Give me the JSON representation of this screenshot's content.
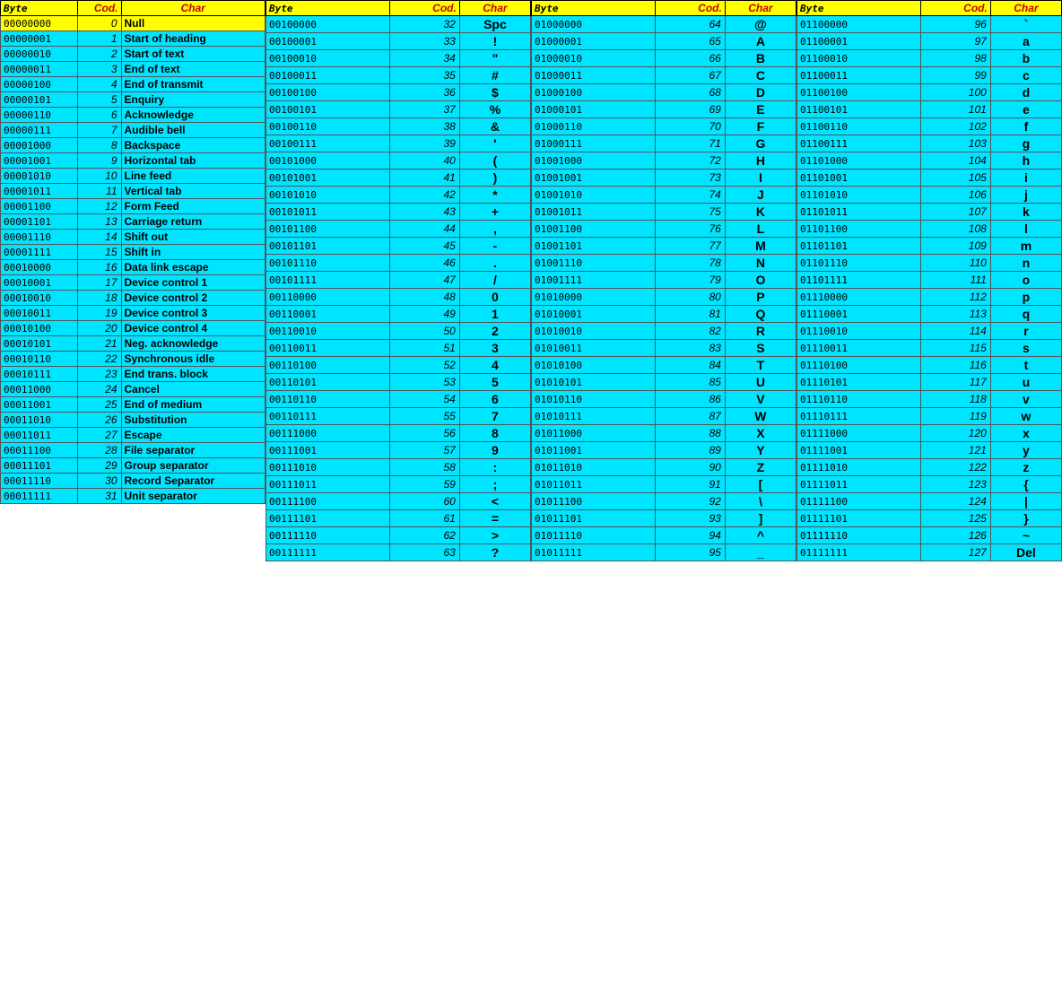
{
  "sections": [
    {
      "id": "s0",
      "headers": [
        "Byte",
        "Cod.",
        "Char"
      ],
      "rows": [
        {
          "byte": "00000000",
          "cod": 0,
          "char": "Null",
          "type": "yellow"
        },
        {
          "byte": "00000001",
          "cod": 1,
          "char": "Start of heading",
          "type": "control"
        },
        {
          "byte": "00000010",
          "cod": 2,
          "char": "Start of text",
          "type": "control"
        },
        {
          "byte": "00000011",
          "cod": 3,
          "char": "End of text",
          "type": "control"
        },
        {
          "byte": "00000100",
          "cod": 4,
          "char": "End of transmit",
          "type": "control"
        },
        {
          "byte": "00000101",
          "cod": 5,
          "char": "Enquiry",
          "type": "control"
        },
        {
          "byte": "00000110",
          "cod": 6,
          "char": "Acknowledge",
          "type": "control"
        },
        {
          "byte": "00000111",
          "cod": 7,
          "char": "Audible bell",
          "type": "control"
        },
        {
          "byte": "00001000",
          "cod": 8,
          "char": "Backspace",
          "type": "control"
        },
        {
          "byte": "00001001",
          "cod": 9,
          "char": "Horizontal tab",
          "type": "control"
        },
        {
          "byte": "00001010",
          "cod": 10,
          "char": "Line feed",
          "type": "control"
        },
        {
          "byte": "00001011",
          "cod": 11,
          "char": "Vertical tab",
          "type": "control"
        },
        {
          "byte": "00001100",
          "cod": 12,
          "char": "Form Feed",
          "type": "control"
        },
        {
          "byte": "00001101",
          "cod": 13,
          "char": "Carriage return",
          "type": "control"
        },
        {
          "byte": "00001110",
          "cod": 14,
          "char": "Shift out",
          "type": "control"
        },
        {
          "byte": "00001111",
          "cod": 15,
          "char": "Shift in",
          "type": "control"
        },
        {
          "byte": "00010000",
          "cod": 16,
          "char": "Data link escape",
          "type": "control"
        },
        {
          "byte": "00010001",
          "cod": 17,
          "char": "Device control 1",
          "type": "control"
        },
        {
          "byte": "00010010",
          "cod": 18,
          "char": "Device control 2",
          "type": "control"
        },
        {
          "byte": "00010011",
          "cod": 19,
          "char": "Device control 3",
          "type": "control"
        },
        {
          "byte": "00010100",
          "cod": 20,
          "char": "Device control 4",
          "type": "control"
        },
        {
          "byte": "00010101",
          "cod": 21,
          "char": "Neg. acknowledge",
          "type": "control"
        },
        {
          "byte": "00010110",
          "cod": 22,
          "char": "Synchronous idle",
          "type": "control"
        },
        {
          "byte": "00010111",
          "cod": 23,
          "char": "End trans. block",
          "type": "control"
        },
        {
          "byte": "00011000",
          "cod": 24,
          "char": "Cancel",
          "type": "control"
        },
        {
          "byte": "00011001",
          "cod": 25,
          "char": "End of medium",
          "type": "control"
        },
        {
          "byte": "00011010",
          "cod": 26,
          "char": "Substitution",
          "type": "control"
        },
        {
          "byte": "00011011",
          "cod": 27,
          "char": "Escape",
          "type": "control"
        },
        {
          "byte": "00011100",
          "cod": 28,
          "char": "File separator",
          "type": "control"
        },
        {
          "byte": "00011101",
          "cod": 29,
          "char": "Group separator",
          "type": "control"
        },
        {
          "byte": "00011110",
          "cod": 30,
          "char": "Record Separator",
          "type": "control"
        },
        {
          "byte": "00011111",
          "cod": 31,
          "char": "Unit separator",
          "type": "control"
        }
      ]
    },
    {
      "id": "s1",
      "headers": [
        "Byte",
        "Cod.",
        "Char"
      ],
      "rows": [
        {
          "byte": "00100000",
          "cod": 32,
          "char": "Spc",
          "type": "printable"
        },
        {
          "byte": "00100001",
          "cod": 33,
          "char": "!",
          "type": "printable"
        },
        {
          "byte": "00100010",
          "cod": 34,
          "char": "\"",
          "type": "printable"
        },
        {
          "byte": "00100011",
          "cod": 35,
          "char": "#",
          "type": "printable"
        },
        {
          "byte": "00100100",
          "cod": 36,
          "char": "$",
          "type": "printable"
        },
        {
          "byte": "00100101",
          "cod": 37,
          "char": "%",
          "type": "printable"
        },
        {
          "byte": "00100110",
          "cod": 38,
          "char": "&",
          "type": "printable"
        },
        {
          "byte": "00100111",
          "cod": 39,
          "char": "'",
          "type": "printable"
        },
        {
          "byte": "00101000",
          "cod": 40,
          "char": "(",
          "type": "printable"
        },
        {
          "byte": "00101001",
          "cod": 41,
          "char": ")",
          "type": "printable"
        },
        {
          "byte": "00101010",
          "cod": 42,
          "char": "*",
          "type": "printable"
        },
        {
          "byte": "00101011",
          "cod": 43,
          "char": "+",
          "type": "printable"
        },
        {
          "byte": "00101100",
          "cod": 44,
          "char": ",",
          "type": "printable"
        },
        {
          "byte": "00101101",
          "cod": 45,
          "char": "-",
          "type": "printable"
        },
        {
          "byte": "00101110",
          "cod": 46,
          "char": ".",
          "type": "printable"
        },
        {
          "byte": "00101111",
          "cod": 47,
          "char": "/",
          "type": "printable"
        },
        {
          "byte": "00110000",
          "cod": 48,
          "char": "0",
          "type": "printable"
        },
        {
          "byte": "00110001",
          "cod": 49,
          "char": "1",
          "type": "printable"
        },
        {
          "byte": "00110010",
          "cod": 50,
          "char": "2",
          "type": "printable"
        },
        {
          "byte": "00110011",
          "cod": 51,
          "char": "3",
          "type": "printable"
        },
        {
          "byte": "00110100",
          "cod": 52,
          "char": "4",
          "type": "printable"
        },
        {
          "byte": "00110101",
          "cod": 53,
          "char": "5",
          "type": "printable"
        },
        {
          "byte": "00110110",
          "cod": 54,
          "char": "6",
          "type": "printable"
        },
        {
          "byte": "00110111",
          "cod": 55,
          "char": "7",
          "type": "printable"
        },
        {
          "byte": "00111000",
          "cod": 56,
          "char": "8",
          "type": "printable"
        },
        {
          "byte": "00111001",
          "cod": 57,
          "char": "9",
          "type": "printable"
        },
        {
          "byte": "00111010",
          "cod": 58,
          "char": ":",
          "type": "printable"
        },
        {
          "byte": "00111011",
          "cod": 59,
          "char": ";",
          "type": "printable"
        },
        {
          "byte": "00111100",
          "cod": 60,
          "char": "<",
          "type": "printable"
        },
        {
          "byte": "00111101",
          "cod": 61,
          "char": "=",
          "type": "printable"
        },
        {
          "byte": "00111110",
          "cod": 62,
          "char": ">",
          "type": "printable"
        },
        {
          "byte": "00111111",
          "cod": 63,
          "char": "?",
          "type": "printable"
        }
      ]
    },
    {
      "id": "s2",
      "headers": [
        "Byte",
        "Cod.",
        "Char"
      ],
      "rows": [
        {
          "byte": "01000000",
          "cod": 64,
          "char": "@",
          "type": "printable"
        },
        {
          "byte": "01000001",
          "cod": 65,
          "char": "A",
          "type": "printable"
        },
        {
          "byte": "01000010",
          "cod": 66,
          "char": "B",
          "type": "printable"
        },
        {
          "byte": "01000011",
          "cod": 67,
          "char": "C",
          "type": "printable"
        },
        {
          "byte": "01000100",
          "cod": 68,
          "char": "D",
          "type": "printable"
        },
        {
          "byte": "01000101",
          "cod": 69,
          "char": "E",
          "type": "printable"
        },
        {
          "byte": "01000110",
          "cod": 70,
          "char": "F",
          "type": "printable"
        },
        {
          "byte": "01000111",
          "cod": 71,
          "char": "G",
          "type": "printable"
        },
        {
          "byte": "01001000",
          "cod": 72,
          "char": "H",
          "type": "printable"
        },
        {
          "byte": "01001001",
          "cod": 73,
          "char": "I",
          "type": "printable"
        },
        {
          "byte": "01001010",
          "cod": 74,
          "char": "J",
          "type": "printable"
        },
        {
          "byte": "01001011",
          "cod": 75,
          "char": "K",
          "type": "printable"
        },
        {
          "byte": "01001100",
          "cod": 76,
          "char": "L",
          "type": "printable"
        },
        {
          "byte": "01001101",
          "cod": 77,
          "char": "M",
          "type": "printable"
        },
        {
          "byte": "01001110",
          "cod": 78,
          "char": "N",
          "type": "printable"
        },
        {
          "byte": "01001111",
          "cod": 79,
          "char": "O",
          "type": "printable"
        },
        {
          "byte": "01010000",
          "cod": 80,
          "char": "P",
          "type": "printable"
        },
        {
          "byte": "01010001",
          "cod": 81,
          "char": "Q",
          "type": "printable"
        },
        {
          "byte": "01010010",
          "cod": 82,
          "char": "R",
          "type": "printable"
        },
        {
          "byte": "01010011",
          "cod": 83,
          "char": "S",
          "type": "printable"
        },
        {
          "byte": "01010100",
          "cod": 84,
          "char": "T",
          "type": "printable"
        },
        {
          "byte": "01010101",
          "cod": 85,
          "char": "U",
          "type": "printable"
        },
        {
          "byte": "01010110",
          "cod": 86,
          "char": "V",
          "type": "printable"
        },
        {
          "byte": "01010111",
          "cod": 87,
          "char": "W",
          "type": "printable"
        },
        {
          "byte": "01011000",
          "cod": 88,
          "char": "X",
          "type": "printable"
        },
        {
          "byte": "01011001",
          "cod": 89,
          "char": "Y",
          "type": "printable"
        },
        {
          "byte": "01011010",
          "cod": 90,
          "char": "Z",
          "type": "printable"
        },
        {
          "byte": "01011011",
          "cod": 91,
          "char": "[",
          "type": "printable"
        },
        {
          "byte": "01011100",
          "cod": 92,
          "char": "\\",
          "type": "printable"
        },
        {
          "byte": "01011101",
          "cod": 93,
          "char": "]",
          "type": "printable"
        },
        {
          "byte": "01011110",
          "cod": 94,
          "char": "^",
          "type": "printable"
        },
        {
          "byte": "01011111",
          "cod": 95,
          "char": "_",
          "type": "printable"
        }
      ]
    },
    {
      "id": "s3",
      "headers": [
        "Byte",
        "Cod.",
        "Char"
      ],
      "rows": [
        {
          "byte": "01100000",
          "cod": 96,
          "char": "`",
          "type": "printable"
        },
        {
          "byte": "01100001",
          "cod": 97,
          "char": "a",
          "type": "printable"
        },
        {
          "byte": "01100010",
          "cod": 98,
          "char": "b",
          "type": "printable"
        },
        {
          "byte": "01100011",
          "cod": 99,
          "char": "c",
          "type": "printable"
        },
        {
          "byte": "01100100",
          "cod": 100,
          "char": "d",
          "type": "printable"
        },
        {
          "byte": "01100101",
          "cod": 101,
          "char": "e",
          "type": "printable"
        },
        {
          "byte": "01100110",
          "cod": 102,
          "char": "f",
          "type": "printable"
        },
        {
          "byte": "01100111",
          "cod": 103,
          "char": "g",
          "type": "printable"
        },
        {
          "byte": "01101000",
          "cod": 104,
          "char": "h",
          "type": "printable"
        },
        {
          "byte": "01101001",
          "cod": 105,
          "char": "i",
          "type": "printable"
        },
        {
          "byte": "01101010",
          "cod": 106,
          "char": "j",
          "type": "printable"
        },
        {
          "byte": "01101011",
          "cod": 107,
          "char": "k",
          "type": "printable"
        },
        {
          "byte": "01101100",
          "cod": 108,
          "char": "l",
          "type": "printable"
        },
        {
          "byte": "01101101",
          "cod": 109,
          "char": "m",
          "type": "printable"
        },
        {
          "byte": "01101110",
          "cod": 110,
          "char": "n",
          "type": "printable"
        },
        {
          "byte": "01101111",
          "cod": 111,
          "char": "o",
          "type": "printable"
        },
        {
          "byte": "01110000",
          "cod": 112,
          "char": "p",
          "type": "printable"
        },
        {
          "byte": "01110001",
          "cod": 113,
          "char": "q",
          "type": "printable"
        },
        {
          "byte": "01110010",
          "cod": 114,
          "char": "r",
          "type": "printable"
        },
        {
          "byte": "01110011",
          "cod": 115,
          "char": "s",
          "type": "printable"
        },
        {
          "byte": "01110100",
          "cod": 116,
          "char": "t",
          "type": "printable"
        },
        {
          "byte": "01110101",
          "cod": 117,
          "char": "u",
          "type": "printable"
        },
        {
          "byte": "01110110",
          "cod": 118,
          "char": "v",
          "type": "printable"
        },
        {
          "byte": "01110111",
          "cod": 119,
          "char": "w",
          "type": "printable"
        },
        {
          "byte": "01111000",
          "cod": 120,
          "char": "x",
          "type": "printable"
        },
        {
          "byte": "01111001",
          "cod": 121,
          "char": "y",
          "type": "printable"
        },
        {
          "byte": "01111010",
          "cod": 122,
          "char": "z",
          "type": "printable"
        },
        {
          "byte": "01111011",
          "cod": 123,
          "char": "{",
          "type": "printable"
        },
        {
          "byte": "01111100",
          "cod": 124,
          "char": "|",
          "type": "printable"
        },
        {
          "byte": "01111101",
          "cod": 125,
          "char": "}",
          "type": "printable"
        },
        {
          "byte": "01111110",
          "cod": 126,
          "char": "~",
          "type": "printable"
        },
        {
          "byte": "01111111",
          "cod": 127,
          "char": "Del",
          "type": "printable"
        }
      ]
    }
  ]
}
